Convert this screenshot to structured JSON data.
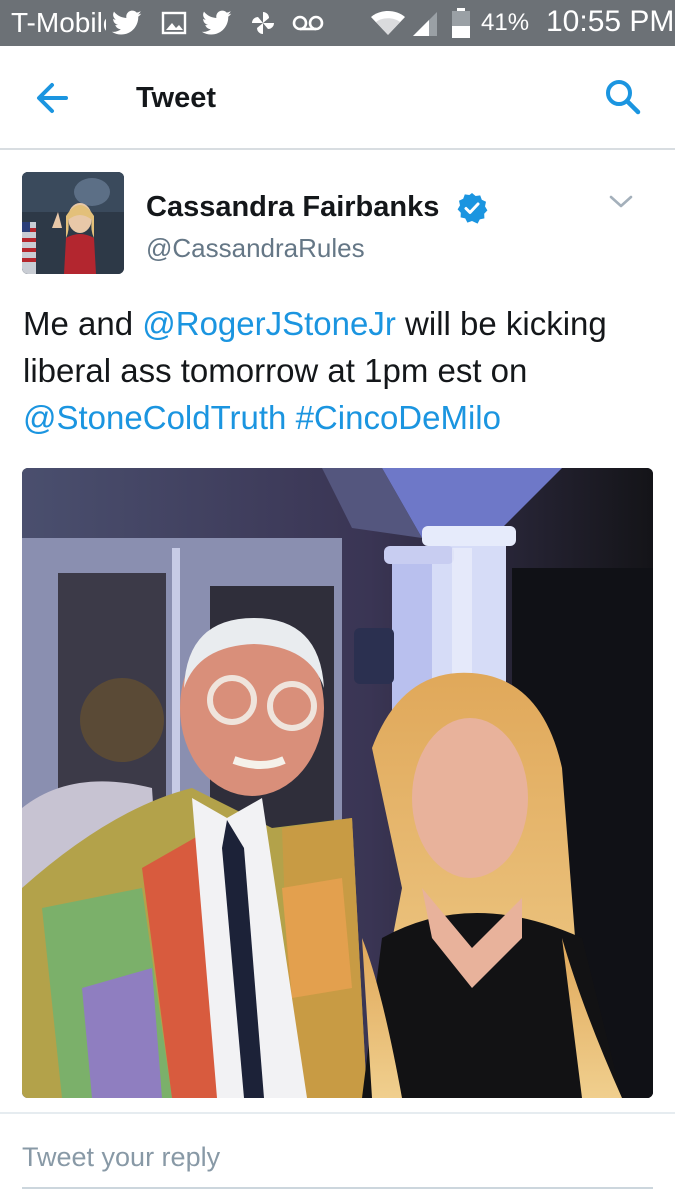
{
  "status_bar": {
    "carrier": "T-Mobile",
    "battery_percent": "41%",
    "time": "10:55 PM",
    "icons": [
      "twitter-icon",
      "image-icon",
      "twitter-icon",
      "pinwheel-icon",
      "voicemail-icon",
      "wifi-icon",
      "signal-icon",
      "battery-icon"
    ]
  },
  "header": {
    "title": "Tweet",
    "icons": [
      "back-arrow-icon",
      "search-icon"
    ],
    "accent_color": "#1b95e0"
  },
  "tweet": {
    "author_name": "Cassandra Fairbanks",
    "handle": "@CassandraRules",
    "text_parts": [
      {
        "type": "text",
        "value": "Me and "
      },
      {
        "type": "mention",
        "value": "@RogerJStoneJr"
      },
      {
        "type": "text",
        "value": " will be kicking liberal ass tomorrow at 1pm est on "
      },
      {
        "type": "mention",
        "value": "@StoneColdTruth"
      },
      {
        "type": "text",
        "value": " "
      },
      {
        "type": "hashtag",
        "value": "#CincoDeMilo"
      }
    ],
    "verified": true
  },
  "reply": {
    "placeholder": "Tweet your reply"
  }
}
